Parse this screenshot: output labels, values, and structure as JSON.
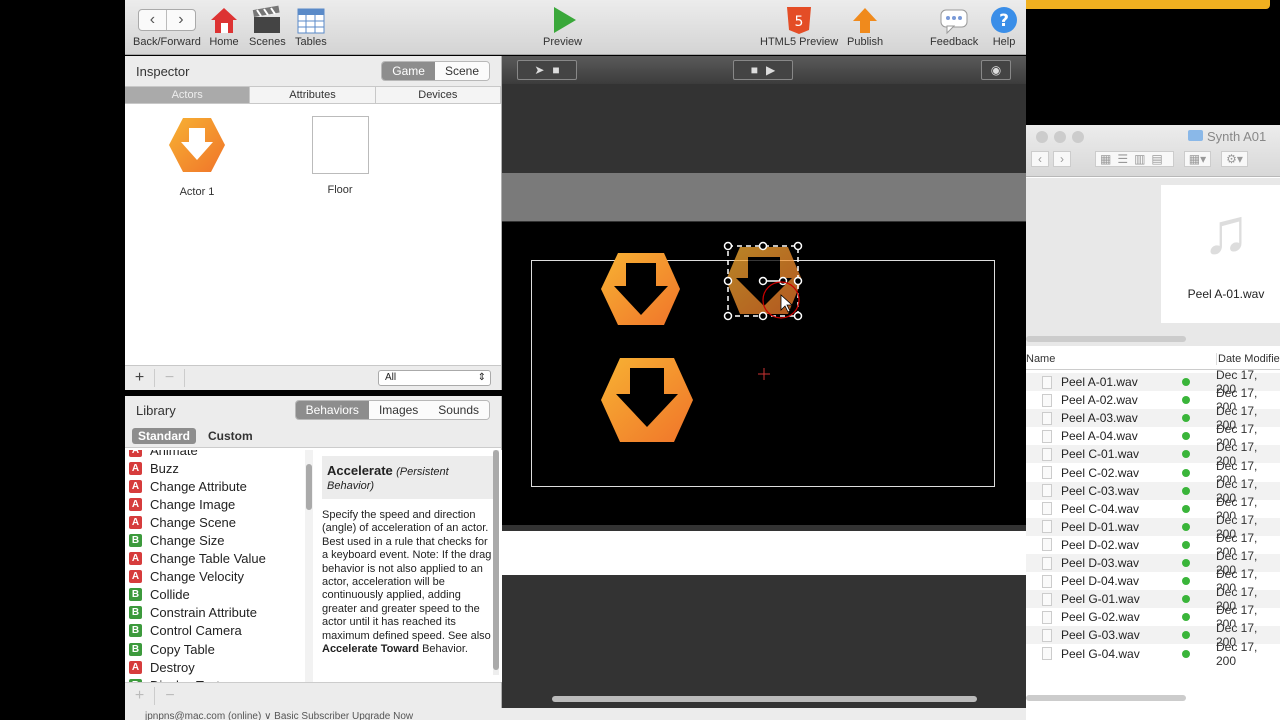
{
  "toolbar": {
    "back_forward": "Back/Forward",
    "home": "Home",
    "scenes": "Scenes",
    "tables": "Tables",
    "preview": "Preview",
    "html5_preview": "HTML5 Preview",
    "publish": "Publish",
    "feedback": "Feedback",
    "help": "Help",
    "html5_badge": "5"
  },
  "inspector": {
    "title": "Inspector",
    "seg_game": "Game",
    "seg_scene": "Scene",
    "tabs": [
      "Actors",
      "Attributes",
      "Devices"
    ],
    "actors": [
      {
        "name": "Actor 1"
      },
      {
        "name": "Floor"
      }
    ],
    "filter": "All"
  },
  "library": {
    "title": "Library",
    "tabs": [
      "Behaviors",
      "Images",
      "Sounds"
    ],
    "sub_standard": "Standard",
    "sub_custom": "Custom",
    "items": [
      {
        "badge": "A",
        "label": "Animate"
      },
      {
        "badge": "A",
        "label": "Buzz"
      },
      {
        "badge": "A",
        "label": "Change Attribute"
      },
      {
        "badge": "A",
        "label": "Change Image"
      },
      {
        "badge": "A",
        "label": "Change Scene"
      },
      {
        "badge": "B",
        "label": "Change Size"
      },
      {
        "badge": "A",
        "label": "Change Table Value"
      },
      {
        "badge": "A",
        "label": "Change Velocity"
      },
      {
        "badge": "B",
        "label": "Collide"
      },
      {
        "badge": "B",
        "label": "Constrain Attribute"
      },
      {
        "badge": "B",
        "label": "Control Camera"
      },
      {
        "badge": "B",
        "label": "Copy Table"
      },
      {
        "badge": "A",
        "label": "Destroy"
      },
      {
        "badge": "B",
        "label": "Display Text"
      }
    ],
    "desc_title": "Accelerate",
    "desc_kind": "(Persistent Behavior)",
    "desc_text": "Specify the speed and direction (angle) of acceleration of an actor. Best used in a rule that checks for a keyboard event. Note: If the drag behavior is not also applied to an actor, acceleration will be continuously applied, adding greater and greater speed to the actor until it has reached its maximum defined speed. See also ",
    "desc_link": "Accelerate Toward",
    "desc_tail": " Behavior."
  },
  "status": {
    "text": "jpnpns@mac.com (online)  ∨   Basic Subscriber Upgrade Now"
  },
  "finder": {
    "title": "Synth A01",
    "preview_name": "Peel A-01.wav",
    "col_name": "Name",
    "col_date": "Date Modifie",
    "files": [
      {
        "name": "Peel A-01.wav",
        "date": "Dec 17, 200"
      },
      {
        "name": "Peel A-02.wav",
        "date": "Dec 17, 200"
      },
      {
        "name": "Peel A-03.wav",
        "date": "Dec 17, 200"
      },
      {
        "name": "Peel A-04.wav",
        "date": "Dec 17, 200"
      },
      {
        "name": "Peel C-01.wav",
        "date": "Dec 17, 200"
      },
      {
        "name": "Peel C-02.wav",
        "date": "Dec 17, 200"
      },
      {
        "name": "Peel C-03.wav",
        "date": "Dec 17, 200"
      },
      {
        "name": "Peel C-04.wav",
        "date": "Dec 17, 200"
      },
      {
        "name": "Peel D-01.wav",
        "date": "Dec 17, 200"
      },
      {
        "name": "Peel D-02.wav",
        "date": "Dec 17, 200"
      },
      {
        "name": "Peel D-03.wav",
        "date": "Dec 17, 200"
      },
      {
        "name": "Peel D-04.wav",
        "date": "Dec 17, 200"
      },
      {
        "name": "Peel G-01.wav",
        "date": "Dec 17, 200"
      },
      {
        "name": "Peel G-02.wav",
        "date": "Dec 17, 200"
      },
      {
        "name": "Peel G-03.wav",
        "date": "Dec 17, 200"
      },
      {
        "name": "Peel G-04.wav",
        "date": "Dec 17, 200"
      }
    ]
  },
  "colors": {
    "accent_orange": "#f59a22",
    "selection_gray": "#8d8d8d",
    "canvas_bg": "#333333"
  }
}
